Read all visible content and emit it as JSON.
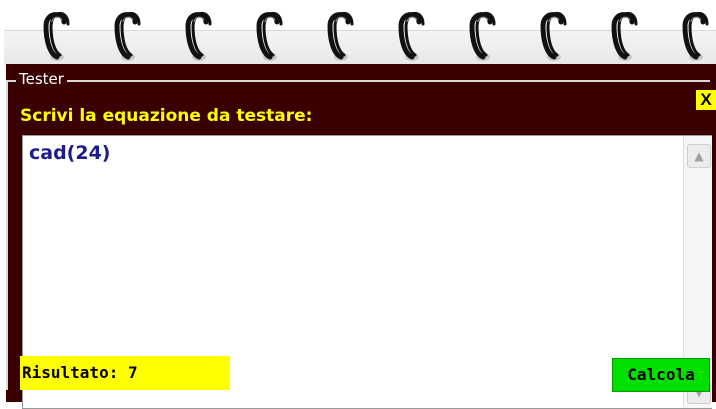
{
  "notebook": {
    "ring_count": 10,
    "ring_icon": "spiral-ring-icon"
  },
  "tester": {
    "legend": "Tester",
    "close_label": "X",
    "prompt": "Scrivi la equazione da testare:",
    "equation": "cad(24)",
    "scroll_up_icon": "▲",
    "scroll_down_icon": "▼",
    "result_label": "Risultato: 7",
    "calc_label": "Calcola"
  },
  "colors": {
    "panel_bg": "#3a0000",
    "accent_yellow": "#ffff00",
    "calc_green": "#00e000",
    "equation_text": "#1c1c8c"
  }
}
